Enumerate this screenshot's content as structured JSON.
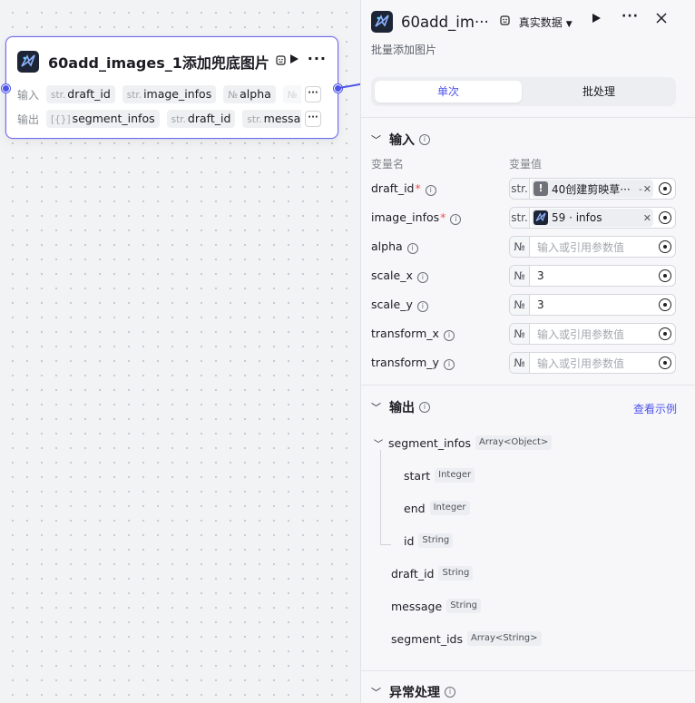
{
  "node": {
    "title": "60add_images_1添加兜底图片",
    "inputs_label": "输入",
    "outputs_label": "输出",
    "inputs": [
      {
        "type": "str.",
        "name": "draft_id"
      },
      {
        "type": "str.",
        "name": "image_infos"
      },
      {
        "type": "№",
        "name": "alpha"
      },
      {
        "type": "№",
        "name": ""
      }
    ],
    "outputs": [
      {
        "type": "[{}]",
        "name": "segment_infos"
      },
      {
        "type": "str.",
        "name": "draft_id"
      },
      {
        "type": "str.",
        "name": "message"
      }
    ],
    "more_label": "···"
  },
  "panel": {
    "title": "60add_im···",
    "data_mode": "真实数据",
    "description": "批量添加图片",
    "tabs": [
      "单次",
      "批处理"
    ],
    "input_section": "输入",
    "col_name": "变量名",
    "col_value": "变量值",
    "inputs": [
      {
        "name": "draft_id",
        "required": true,
        "type": "str.",
        "ref_label": "40创建剪映草···",
        "ref_dash": "-"
      },
      {
        "name": "image_infos",
        "required": true,
        "type": "str.",
        "ref_label": "59 · infos"
      },
      {
        "name": "alpha",
        "type": "№",
        "placeholder": "输入或引用参数值"
      },
      {
        "name": "scale_x",
        "type": "№",
        "value": "3"
      },
      {
        "name": "scale_y",
        "type": "№",
        "value": "3"
      },
      {
        "name": "transform_x",
        "type": "№",
        "placeholder": "输入或引用参数值"
      },
      {
        "name": "transform_y",
        "type": "№",
        "placeholder": "输入或引用参数值"
      }
    ],
    "output_section": "输出",
    "view_example": "查看示例",
    "outputs": [
      {
        "name": "segment_infos",
        "type": "Array<Object>"
      },
      {
        "name": "start",
        "type": "Integer"
      },
      {
        "name": "end",
        "type": "Integer"
      },
      {
        "name": "id",
        "type": "String"
      },
      {
        "name": "draft_id",
        "type": "String"
      },
      {
        "name": "message",
        "type": "String"
      },
      {
        "name": "segment_ids",
        "type": "Array<String>"
      }
    ],
    "exception_section": "异常处理"
  },
  "icons": [
    "plugin-logo-icon",
    "template-icon",
    "play-icon",
    "more-icon",
    "close-icon",
    "info-icon",
    "target-icon",
    "warning-icon",
    "chevron-down-icon",
    "chevron-up-icon"
  ]
}
